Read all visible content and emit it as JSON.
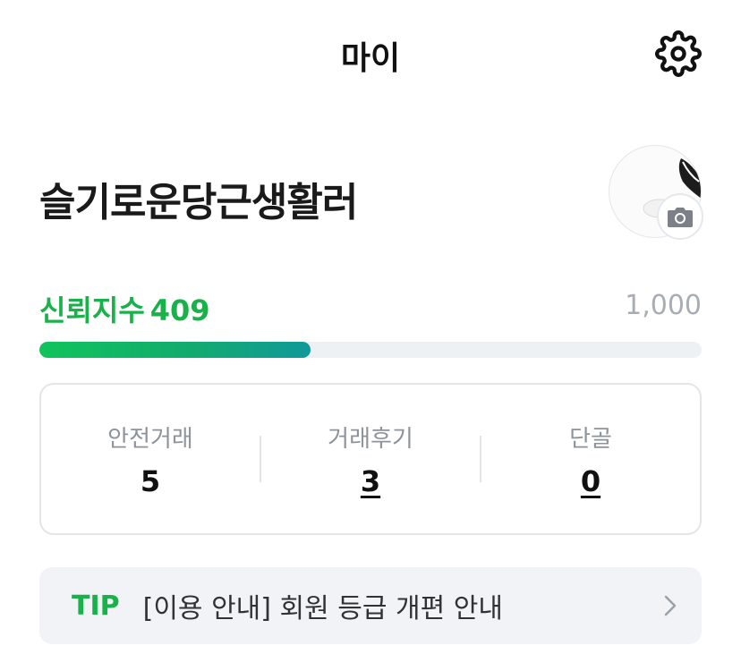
{
  "header": {
    "title": "마이",
    "settings_icon": "gear-icon"
  },
  "profile": {
    "nickname": "슬기로운당근생활러",
    "camera_icon": "camera-icon"
  },
  "trust": {
    "label": "신뢰지수",
    "score": "409",
    "max": "1,000",
    "progress": 0.409,
    "accent_color": "#19b24a"
  },
  "stats": [
    {
      "label": "안전거래",
      "value": "5"
    },
    {
      "label": "거래후기",
      "value": "3"
    },
    {
      "label": "단골",
      "value": "0"
    }
  ],
  "tip": {
    "tag": "TIP",
    "text": "[이용 안내] 회원 등급 개편 안내",
    "chevron_icon": "chevron-right-icon"
  }
}
